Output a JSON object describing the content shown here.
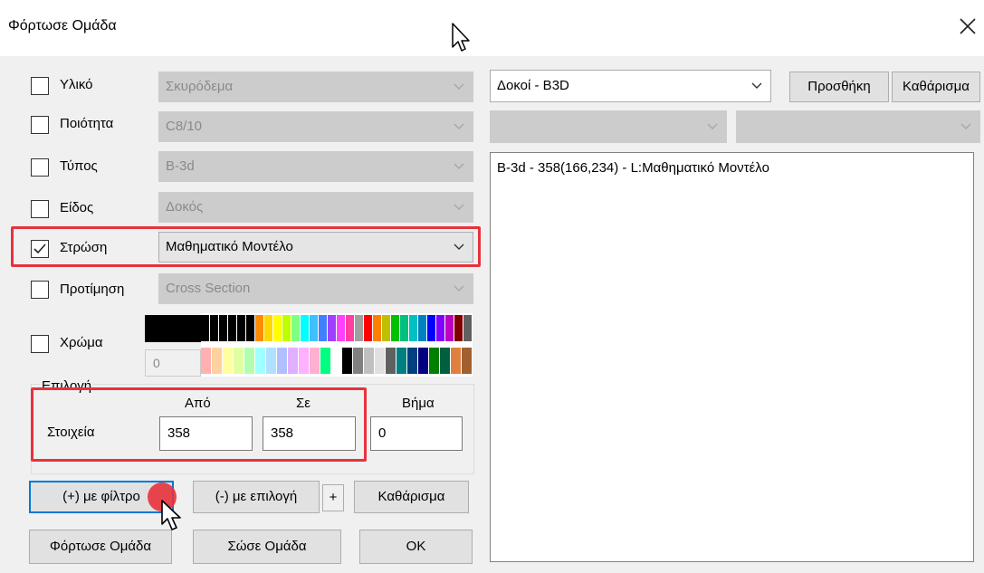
{
  "window": {
    "title": "Φόρτωσε Ομάδα"
  },
  "filters": [
    {
      "label": "Υλικό",
      "checked": false,
      "value": "Σκυρόδεμα",
      "enabled": false
    },
    {
      "label": "Ποιότητα",
      "checked": false,
      "value": "C8/10",
      "enabled": false
    },
    {
      "label": "Τύπος",
      "checked": false,
      "value": "B-3d",
      "enabled": false
    },
    {
      "label": "Είδος",
      "checked": false,
      "value": "Δοκός",
      "enabled": false
    },
    {
      "label": "Στρώση",
      "checked": true,
      "value": "Μαθηματικό Μοντέλο",
      "enabled": true
    },
    {
      "label": "Προτίμηση",
      "checked": false,
      "value": "Cross Section",
      "enabled": false
    }
  ],
  "color": {
    "label": "Χρώμα",
    "index_value": "0"
  },
  "selection": {
    "group_label": "Επιλογή",
    "from_label": "Από",
    "to_label": "Σε",
    "step_label": "Βήμα",
    "row_label": "Στοιχεία",
    "from_value": "358",
    "to_value": "358",
    "step_value": "0"
  },
  "buttons": {
    "add_filter": "(+) με φίλτρο",
    "remove_selection": "(-) με επιλογή",
    "plus": "+",
    "clear_left": "Καθάρισμα",
    "load_group": "Φόρτωσε Ομάδα",
    "save_group": "Σώσε Ομάδα",
    "ok": "OK",
    "add": "Προσθήκη",
    "clear_right": "Καθάρισμα"
  },
  "right_panel": {
    "type_combo": "Δοκοί - B3D",
    "list_items": [
      "B-3d - 358(166,234) - L:Μαθηματικό Μοντέλο"
    ]
  },
  "palette_top": [
    "#000000",
    "#000000",
    "#000000",
    "#000000",
    "#000000",
    "#000000",
    "#ff8c00",
    "#ffd700",
    "#ffff00",
    "#c0ff00",
    "#80ff80",
    "#00ffff",
    "#40c0ff",
    "#4080ff",
    "#a040ff",
    "#ff40ff",
    "#ff40a0",
    "#a0a0a0",
    "#ff0000",
    "#ff8000",
    "#c0c000",
    "#00c000",
    "#00c080",
    "#00c0c0",
    "#0080c0",
    "#0000ff",
    "#8000ff",
    "#c000c0",
    "#800000",
    "#606060"
  ],
  "palette_bottom": [
    "#ffb0b0",
    "#ffd0a0",
    "#ffffa0",
    "#e0ffa0",
    "#b0ffb0",
    "#a0ffff",
    "#b0e0ff",
    "#b0c0ff",
    "#e0b0ff",
    "#ffb0ff",
    "#ffb0d0",
    "#00ff80",
    "#ffffff",
    "#000000",
    "#808080",
    "#c0c0c0",
    "#e0e0e0",
    "#606060",
    "#008080",
    "#004080",
    "#000080",
    "#008000",
    "#006040",
    "#e08040",
    "#a06030"
  ]
}
